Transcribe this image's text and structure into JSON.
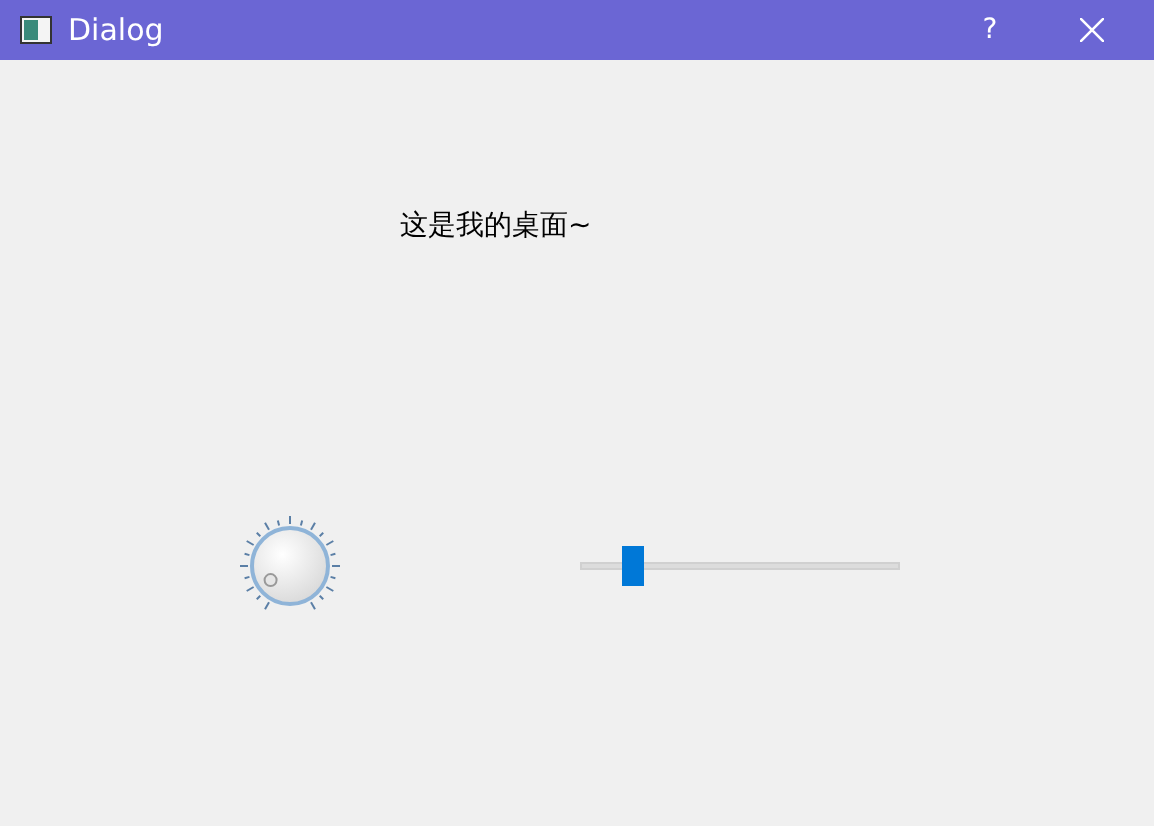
{
  "window": {
    "title": "Dialog",
    "help_button": "?"
  },
  "label": "这是我的桌面~",
  "slider": {
    "level": 0.14
  }
}
